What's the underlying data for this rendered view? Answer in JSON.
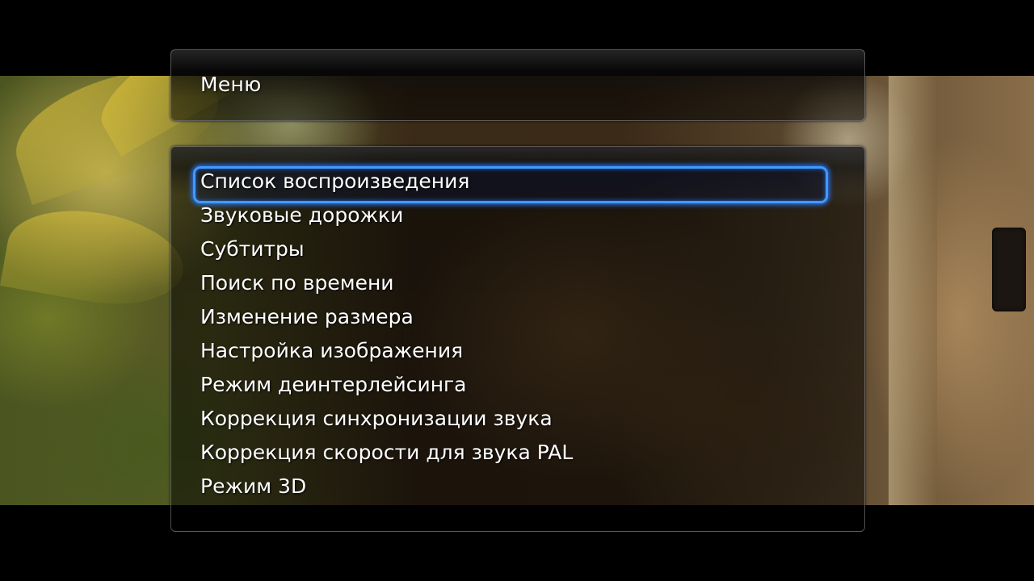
{
  "header": {
    "title": "Меню"
  },
  "menu": {
    "selected_index": 0,
    "items": [
      {
        "label": "Список воспроизведения"
      },
      {
        "label": "Звуковые дорожки"
      },
      {
        "label": "Субтитры"
      },
      {
        "label": "Поиск по времени"
      },
      {
        "label": "Изменение размера"
      },
      {
        "label": "Настройка изображения"
      },
      {
        "label": "Режим деинтерлейсинга"
      },
      {
        "label": "Коррекция синхронизации звука"
      },
      {
        "label": "Коррекция скорости для звука PAL"
      },
      {
        "label": "Режим 3D"
      }
    ]
  },
  "colors": {
    "highlight": "#3f9bff",
    "text": "#ffffff",
    "background": "#000000"
  }
}
